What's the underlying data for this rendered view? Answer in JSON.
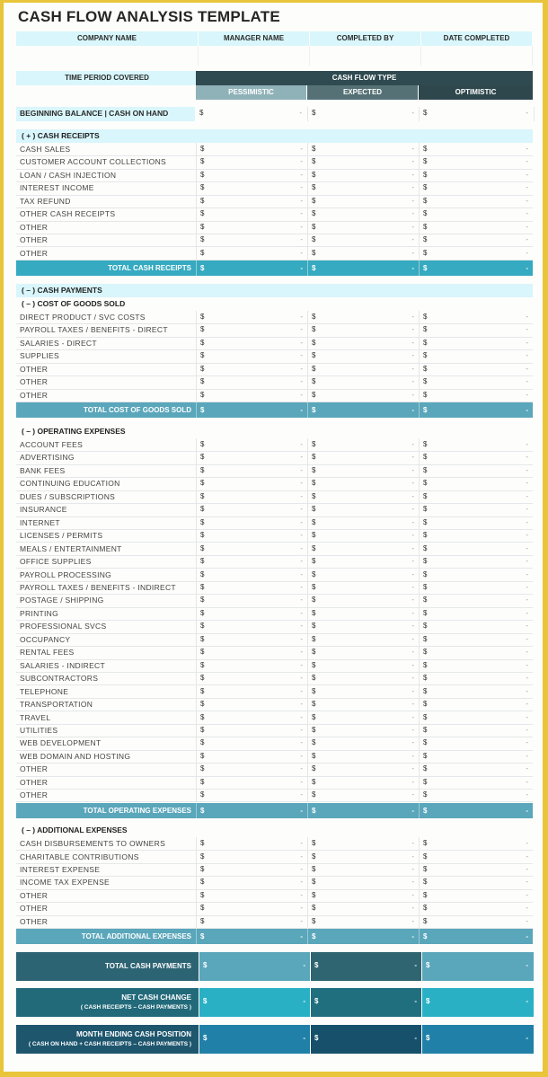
{
  "title": "CASH FLOW ANALYSIS TEMPLATE",
  "header_fields": [
    "COMPANY NAME",
    "MANAGER NAME",
    "COMPLETED BY",
    "DATE COMPLETED"
  ],
  "time_period_label": "TIME PERIOD COVERED",
  "cash_flow_type_label": "CASH FLOW TYPE",
  "scenarios": [
    "PESSIMISTIC",
    "EXPECTED",
    "OPTIMISTIC"
  ],
  "currency_symbol": "$",
  "empty_value": "-",
  "beginning_balance_label": "BEGINNING BALANCE | CASH ON HAND",
  "colors": {
    "frame": "#e8c53a",
    "header_light": "#d8f6fb",
    "cash_flow_type": "#2f4a50",
    "pessimistic": "#8fb2b8",
    "expected": "#557176",
    "optimistic": "#2e474c",
    "total_receipts": "#35aac0",
    "total_section": "#5aa6ba",
    "total_payments_label": "#2d6474",
    "net_change_label": "#226a7a",
    "month_end_label": "#1e566e"
  },
  "sections": [
    {
      "id": "cash-receipts",
      "heading": "( + )  CASH RECEIPTS",
      "items": [
        "CASH SALES",
        "CUSTOMER ACCOUNT COLLECTIONS",
        "LOAN / CASH INJECTION",
        "INTEREST INCOME",
        "TAX REFUND",
        "OTHER CASH RECEIPTS",
        "OTHER",
        "OTHER",
        "OTHER"
      ],
      "total_label": "TOTAL CASH RECEIPTS"
    },
    {
      "id": "cost-of-goods-sold",
      "pre_heading": "( – )  CASH PAYMENTS",
      "heading": "( – )  COST OF GOODS SOLD",
      "items": [
        "DIRECT PRODUCT / SVC COSTS",
        "PAYROLL TAXES / BENEFITS - DIRECT",
        "SALARIES - DIRECT",
        "SUPPLIES",
        "OTHER",
        "OTHER",
        "OTHER"
      ],
      "total_label": "TOTAL COST OF GOODS SOLD"
    },
    {
      "id": "operating-expenses",
      "heading": "( – )  OPERATING EXPENSES",
      "items": [
        "ACCOUNT FEES",
        "ADVERTISING",
        "BANK FEES",
        "CONTINUING EDUCATION",
        "DUES / SUBSCRIPTIONS",
        "INSURANCE",
        "INTERNET",
        "LICENSES / PERMITS",
        "MEALS / ENTERTAINMENT",
        "OFFICE SUPPLIES",
        "PAYROLL PROCESSING",
        "PAYROLL TAXES / BENEFITS - INDIRECT",
        "POSTAGE / SHIPPING",
        "PRINTING",
        "PROFESSIONAL SVCS",
        "OCCUPANCY",
        "RENTAL FEES",
        "SALARIES - INDIRECT",
        "SUBCONTRACTORS",
        "TELEPHONE",
        "TRANSPORTATION",
        "TRAVEL",
        "UTILITIES",
        "WEB DEVELOPMENT",
        "WEB DOMAIN AND HOSTING",
        "OTHER",
        "OTHER",
        "OTHER"
      ],
      "total_label": "TOTAL OPERATING EXPENSES"
    },
    {
      "id": "additional-expenses",
      "heading": "( – )  ADDITIONAL EXPENSES",
      "items": [
        "CASH DISBURSEMENTS TO OWNERS",
        "CHARITABLE CONTRIBUTIONS",
        "INTEREST EXPENSE",
        "INCOME TAX EXPENSE",
        "OTHER",
        "OTHER",
        "OTHER"
      ],
      "total_label": "TOTAL ADDITIONAL EXPENSES"
    }
  ],
  "summary": [
    {
      "id": "total-cash-payments",
      "label": "TOTAL CASH PAYMENTS",
      "sub": ""
    },
    {
      "id": "net-cash-change",
      "label": "NET CASH CHANGE",
      "sub": "( CASH RECEIPTS – CASH PAYMENTS )"
    },
    {
      "id": "month-ending-cash-position",
      "label": "MONTH ENDING CASH POSITION",
      "sub": "( CASH ON HAND + CASH RECEIPTS – CASH PAYMENTS )"
    }
  ]
}
